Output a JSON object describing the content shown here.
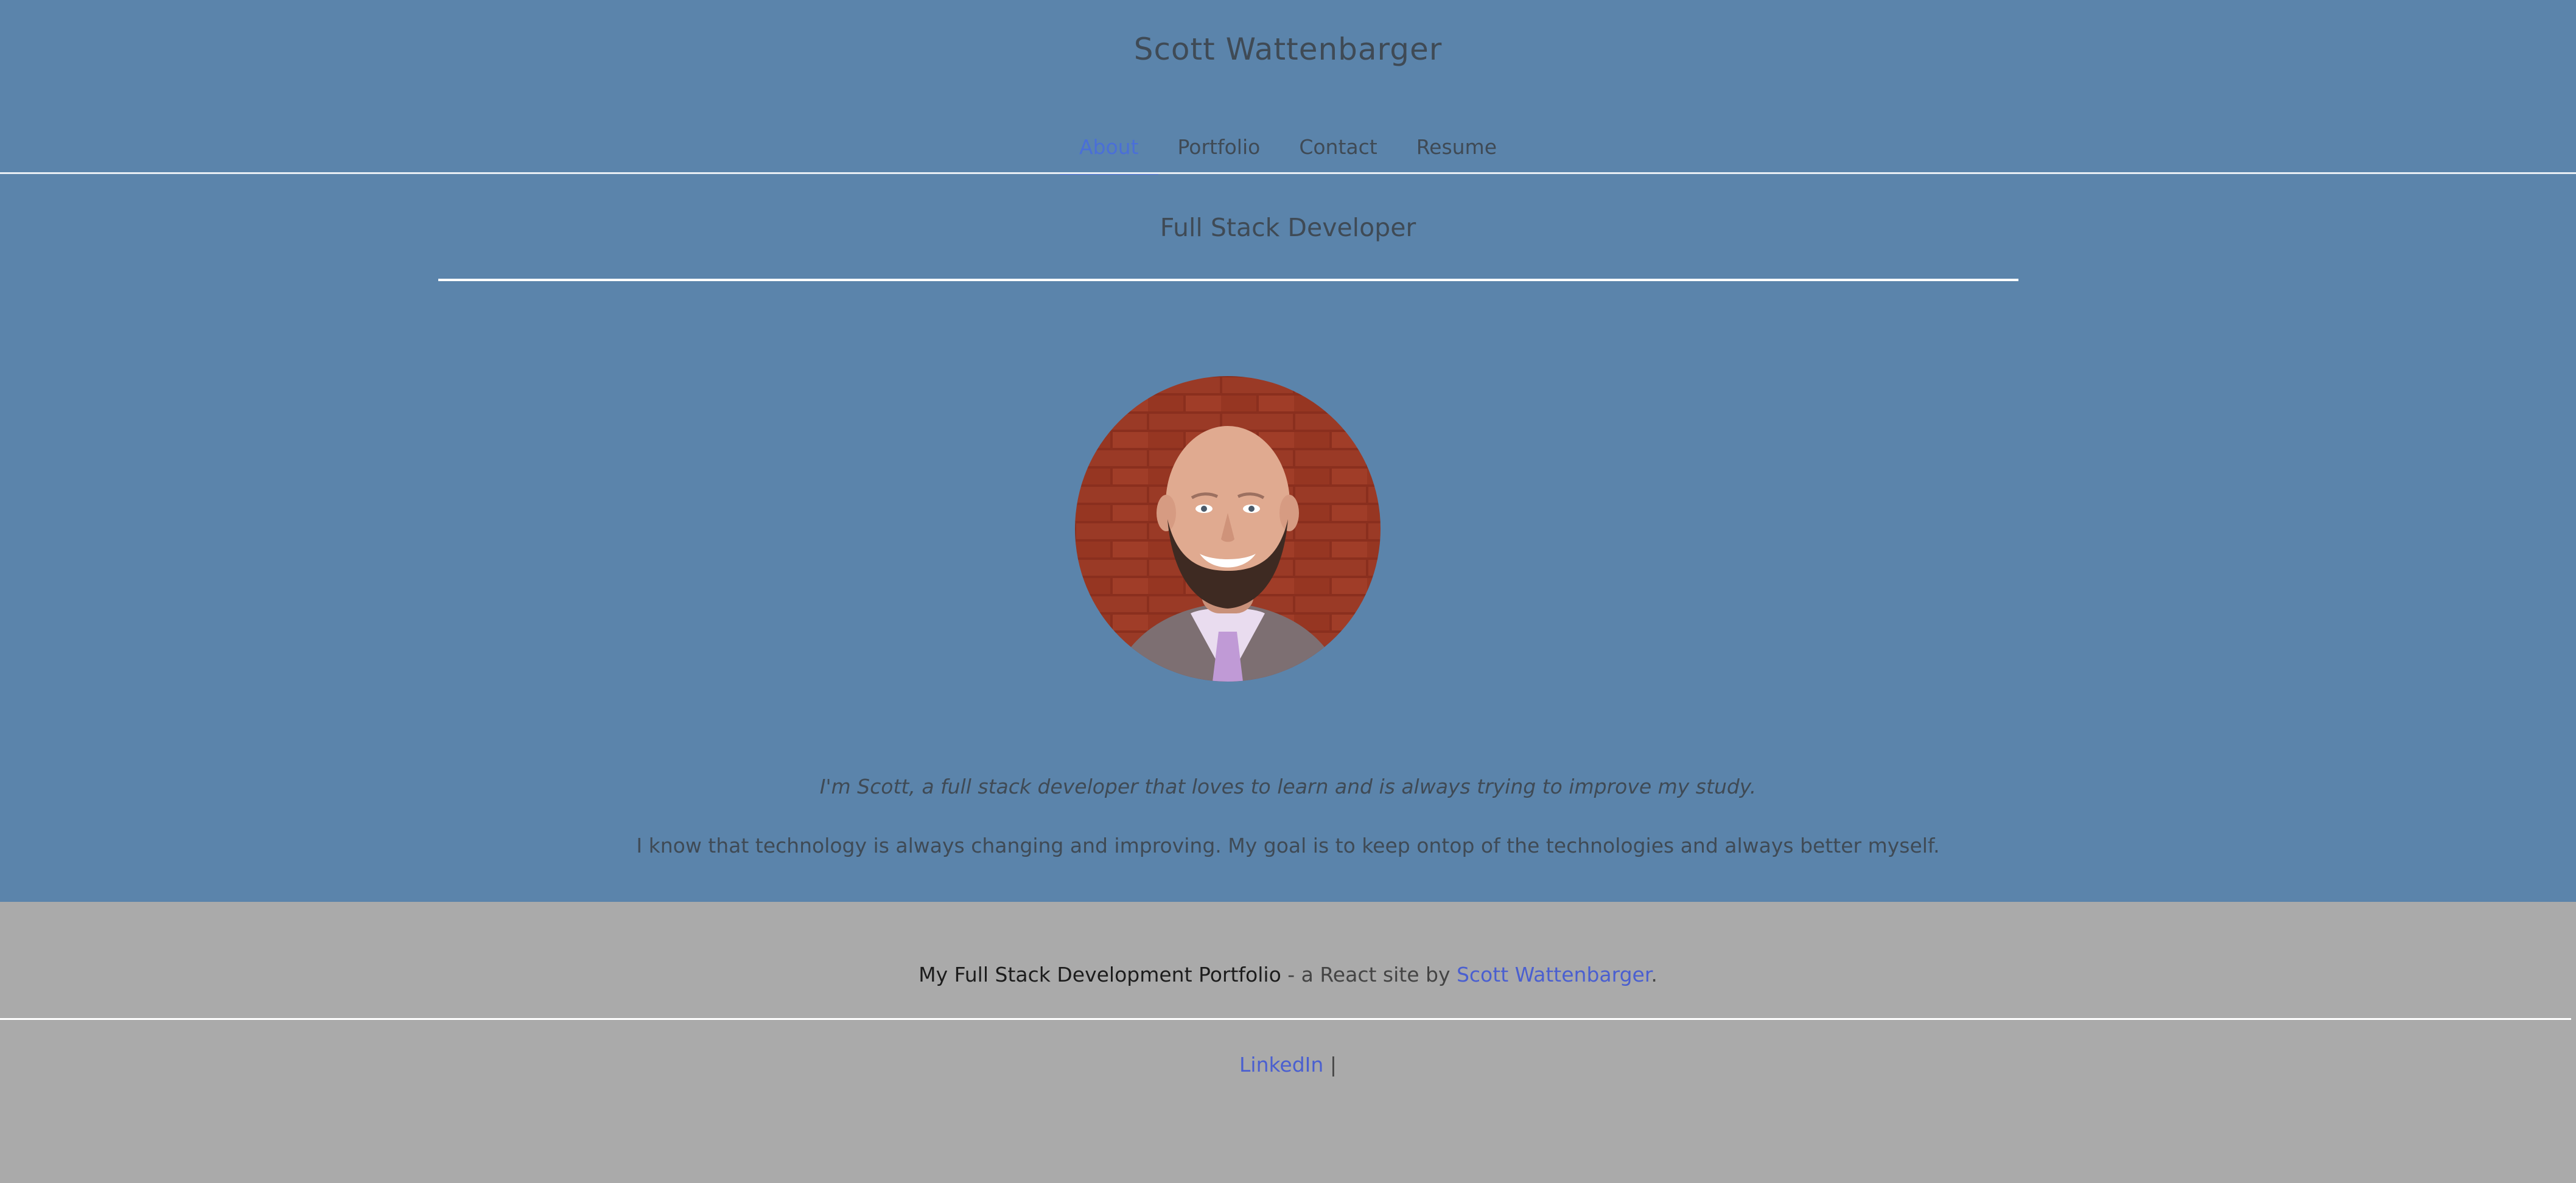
{
  "header": {
    "site_title": "Scott Wattenbarger"
  },
  "nav": {
    "items": [
      {
        "label": "About",
        "active": true
      },
      {
        "label": "Portfolio",
        "active": false
      },
      {
        "label": "Contact",
        "active": false
      },
      {
        "label": "Resume",
        "active": false
      }
    ]
  },
  "main": {
    "subtitle": "Full Stack Developer",
    "avatar_icon": "profile-photo",
    "intro": "I'm Scott, a full stack developer that loves to learn and is always trying to improve my study.",
    "goal": "I know that technology is always changing and improving. My goal is to keep ontop of the technologies and always better myself."
  },
  "footer": {
    "project_name": "My Full Stack Development Portfolio",
    "by_text": " - a React site by ",
    "author_link": "Scott Wattenbarger",
    "period": ".",
    "social_link": "LinkedIn",
    "separator": " |"
  },
  "colors": {
    "page_background": "#5b84ab",
    "footer_background": "#aaaaaa",
    "text": "#3f4a55",
    "accent_link": "#4a6fd8"
  }
}
